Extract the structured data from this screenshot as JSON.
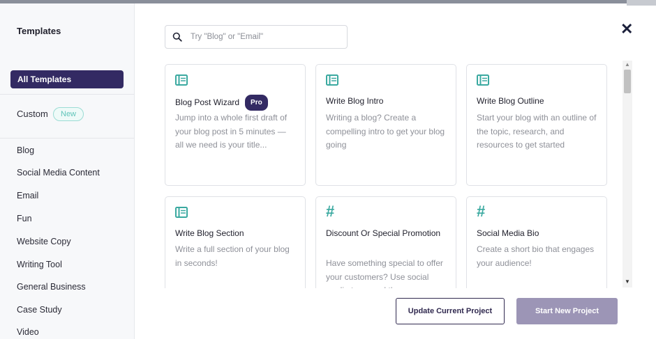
{
  "sidebar": {
    "title": "Templates",
    "active_item": "All Templates",
    "custom_label": "Custom",
    "custom_badge": "New",
    "items": [
      {
        "label": "Blog"
      },
      {
        "label": "Social Media Content"
      },
      {
        "label": "Email"
      },
      {
        "label": "Fun"
      },
      {
        "label": "Website Copy"
      },
      {
        "label": "Writing Tool"
      },
      {
        "label": "General Business"
      },
      {
        "label": "Case Study"
      },
      {
        "label": "Video"
      }
    ]
  },
  "search": {
    "placeholder": "Try \"Blog\" or \"Email\""
  },
  "cards": [
    {
      "icon": "newspaper-icon",
      "title": "Blog Post Wizard",
      "badge": "Pro",
      "description": "Jump into a whole first draft of your blog post in 5 minutes — all we need is your title..."
    },
    {
      "icon": "newspaper-icon",
      "title": "Write Blog Intro",
      "description": "Writing a blog? Create a compelling intro to get your blog going"
    },
    {
      "icon": "newspaper-icon",
      "title": "Write Blog Outline",
      "description": "Start your blog with an outline of the topic, research, and resources to get started"
    },
    {
      "icon": "newspaper-icon",
      "title": "Write Blog Section",
      "description": "Write a full section of your blog in seconds!"
    },
    {
      "icon": "hashtag-icon",
      "title": "Discount Or Special Promotion",
      "description": "Have something special to offer your customers? Use social media to spread the"
    },
    {
      "icon": "hashtag-icon",
      "title": "Social Media Bio",
      "description": "Create a short bio that engages your audience!"
    }
  ],
  "buttons": {
    "update": "Update Current Project",
    "start": "Start New Project"
  },
  "icons": {
    "close": "✕",
    "hash": "#"
  },
  "colors": {
    "accent": "#332a63",
    "teal": "#3aa9a0",
    "start_disabled": "#9c95b6"
  }
}
